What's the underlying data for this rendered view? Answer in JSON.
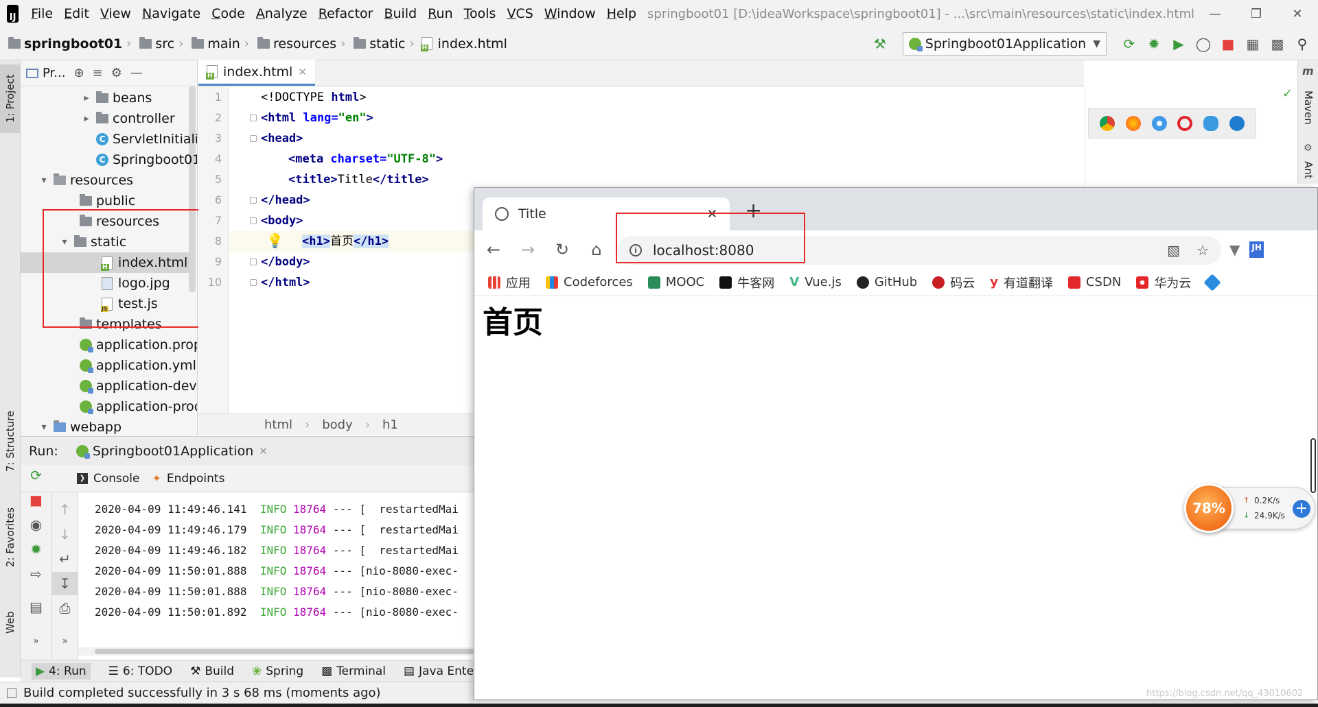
{
  "menu": {
    "items": [
      "File",
      "Edit",
      "View",
      "Navigate",
      "Code",
      "Analyze",
      "Refactor",
      "Build",
      "Run",
      "Tools",
      "VCS",
      "Window",
      "Help"
    ],
    "window_title": "springboot01 [D:\\ideaWorkspace\\springboot01] - ...\\src\\main\\resources\\static\\index.html"
  },
  "navbar": {
    "crumbs": [
      "springboot01",
      "src",
      "main",
      "resources",
      "static",
      "index.html"
    ],
    "run_config": "Springboot01Application"
  },
  "left_strip": {
    "project": "1: Project",
    "structure": "7: Structure",
    "favorites": "2: Favorites",
    "web": "Web"
  },
  "project_panel": {
    "header": "Pr...",
    "tree": [
      "beans",
      "controller",
      "ServletInitiali",
      "Springboot01",
      "resources",
      "public",
      "resources",
      "static",
      "index.html",
      "logo.jpg",
      "test.js",
      "templates",
      "application.prop",
      "application.yml",
      "application-dev.p",
      "application-prod",
      "webapp"
    ]
  },
  "editor": {
    "tab": "index.html",
    "line_numbers": [
      "1",
      "2",
      "3",
      "4",
      "5",
      "6",
      "7",
      "8",
      "9",
      "10"
    ],
    "code": {
      "l1_a": "<!DOCTYPE ",
      "l1_b": "html",
      "l1_c": ">",
      "l2_tag": "<html ",
      "l2_attr": "lang=",
      "l2_val": "\"en\"",
      "l2_end": ">",
      "l3": "<head>",
      "l4_tag": "<meta ",
      "l4_attr": "charset=",
      "l4_val": "\"UTF-8\"",
      "l4_end": ">",
      "l5_open": "<title>",
      "l5_text": "Title",
      "l5_close": "</title>",
      "l6": "</head>",
      "l7": "<body>",
      "l8_open": "<h1>",
      "l8_text": "首页",
      "l8_close": "</h1>",
      "l9": "</body>",
      "l10": "</html>"
    },
    "breadcrumb": [
      "html",
      "body",
      "h1"
    ]
  },
  "right_strip": {
    "maven": "Maven",
    "ant": "Ant"
  },
  "run_panel": {
    "label": "Run:",
    "app_tab": "Springboot01Application",
    "tabs": [
      "Console",
      "Endpoints"
    ],
    "logs": [
      {
        "ts": "2020-04-09 11:49:46.141",
        "level": "INFO",
        "pid": "18764",
        "sep": "---",
        "thread": "[  restartedMai"
      },
      {
        "ts": "2020-04-09 11:49:46.179",
        "level": "INFO",
        "pid": "18764",
        "sep": "---",
        "thread": "[  restartedMai"
      },
      {
        "ts": "2020-04-09 11:49:46.182",
        "level": "INFO",
        "pid": "18764",
        "sep": "---",
        "thread": "[  restartedMai"
      },
      {
        "ts": "2020-04-09 11:50:01.888",
        "level": "INFO",
        "pid": "18764",
        "sep": "---",
        "thread": "[nio-8080-exec-"
      },
      {
        "ts": "2020-04-09 11:50:01.888",
        "level": "INFO",
        "pid": "18764",
        "sep": "---",
        "thread": "[nio-8080-exec-"
      },
      {
        "ts": "2020-04-09 11:50:01.892",
        "level": "INFO",
        "pid": "18764",
        "sep": "---",
        "thread": "[nio-8080-exec-"
      }
    ]
  },
  "bottom_tabs": [
    "4: Run",
    "6: TODO",
    "Build",
    "Spring",
    "Terminal",
    "Java Ente"
  ],
  "status": {
    "message": "Build completed successfully in 3 s 68 ms (moments ago)"
  },
  "browser": {
    "tab_title": "Title",
    "url": "localhost:8080",
    "bookmarks": [
      "应用",
      "Codeforces",
      "MOOC",
      "牛客网",
      "Vue.js",
      "GitHub",
      "码云",
      "有道翻译",
      "CSDN",
      "华为云"
    ],
    "page_heading": "首页"
  },
  "net_widget": {
    "percent": "78%",
    "up": "0.2K/s",
    "down": "24.9K/s"
  },
  "watermark": "https://blog.csdn.net/qq_43010602",
  "colors": {
    "annotation": "#e82828",
    "accent": "#4a86c8",
    "log_info": "#3da836",
    "log_pid": "#b000b0"
  }
}
